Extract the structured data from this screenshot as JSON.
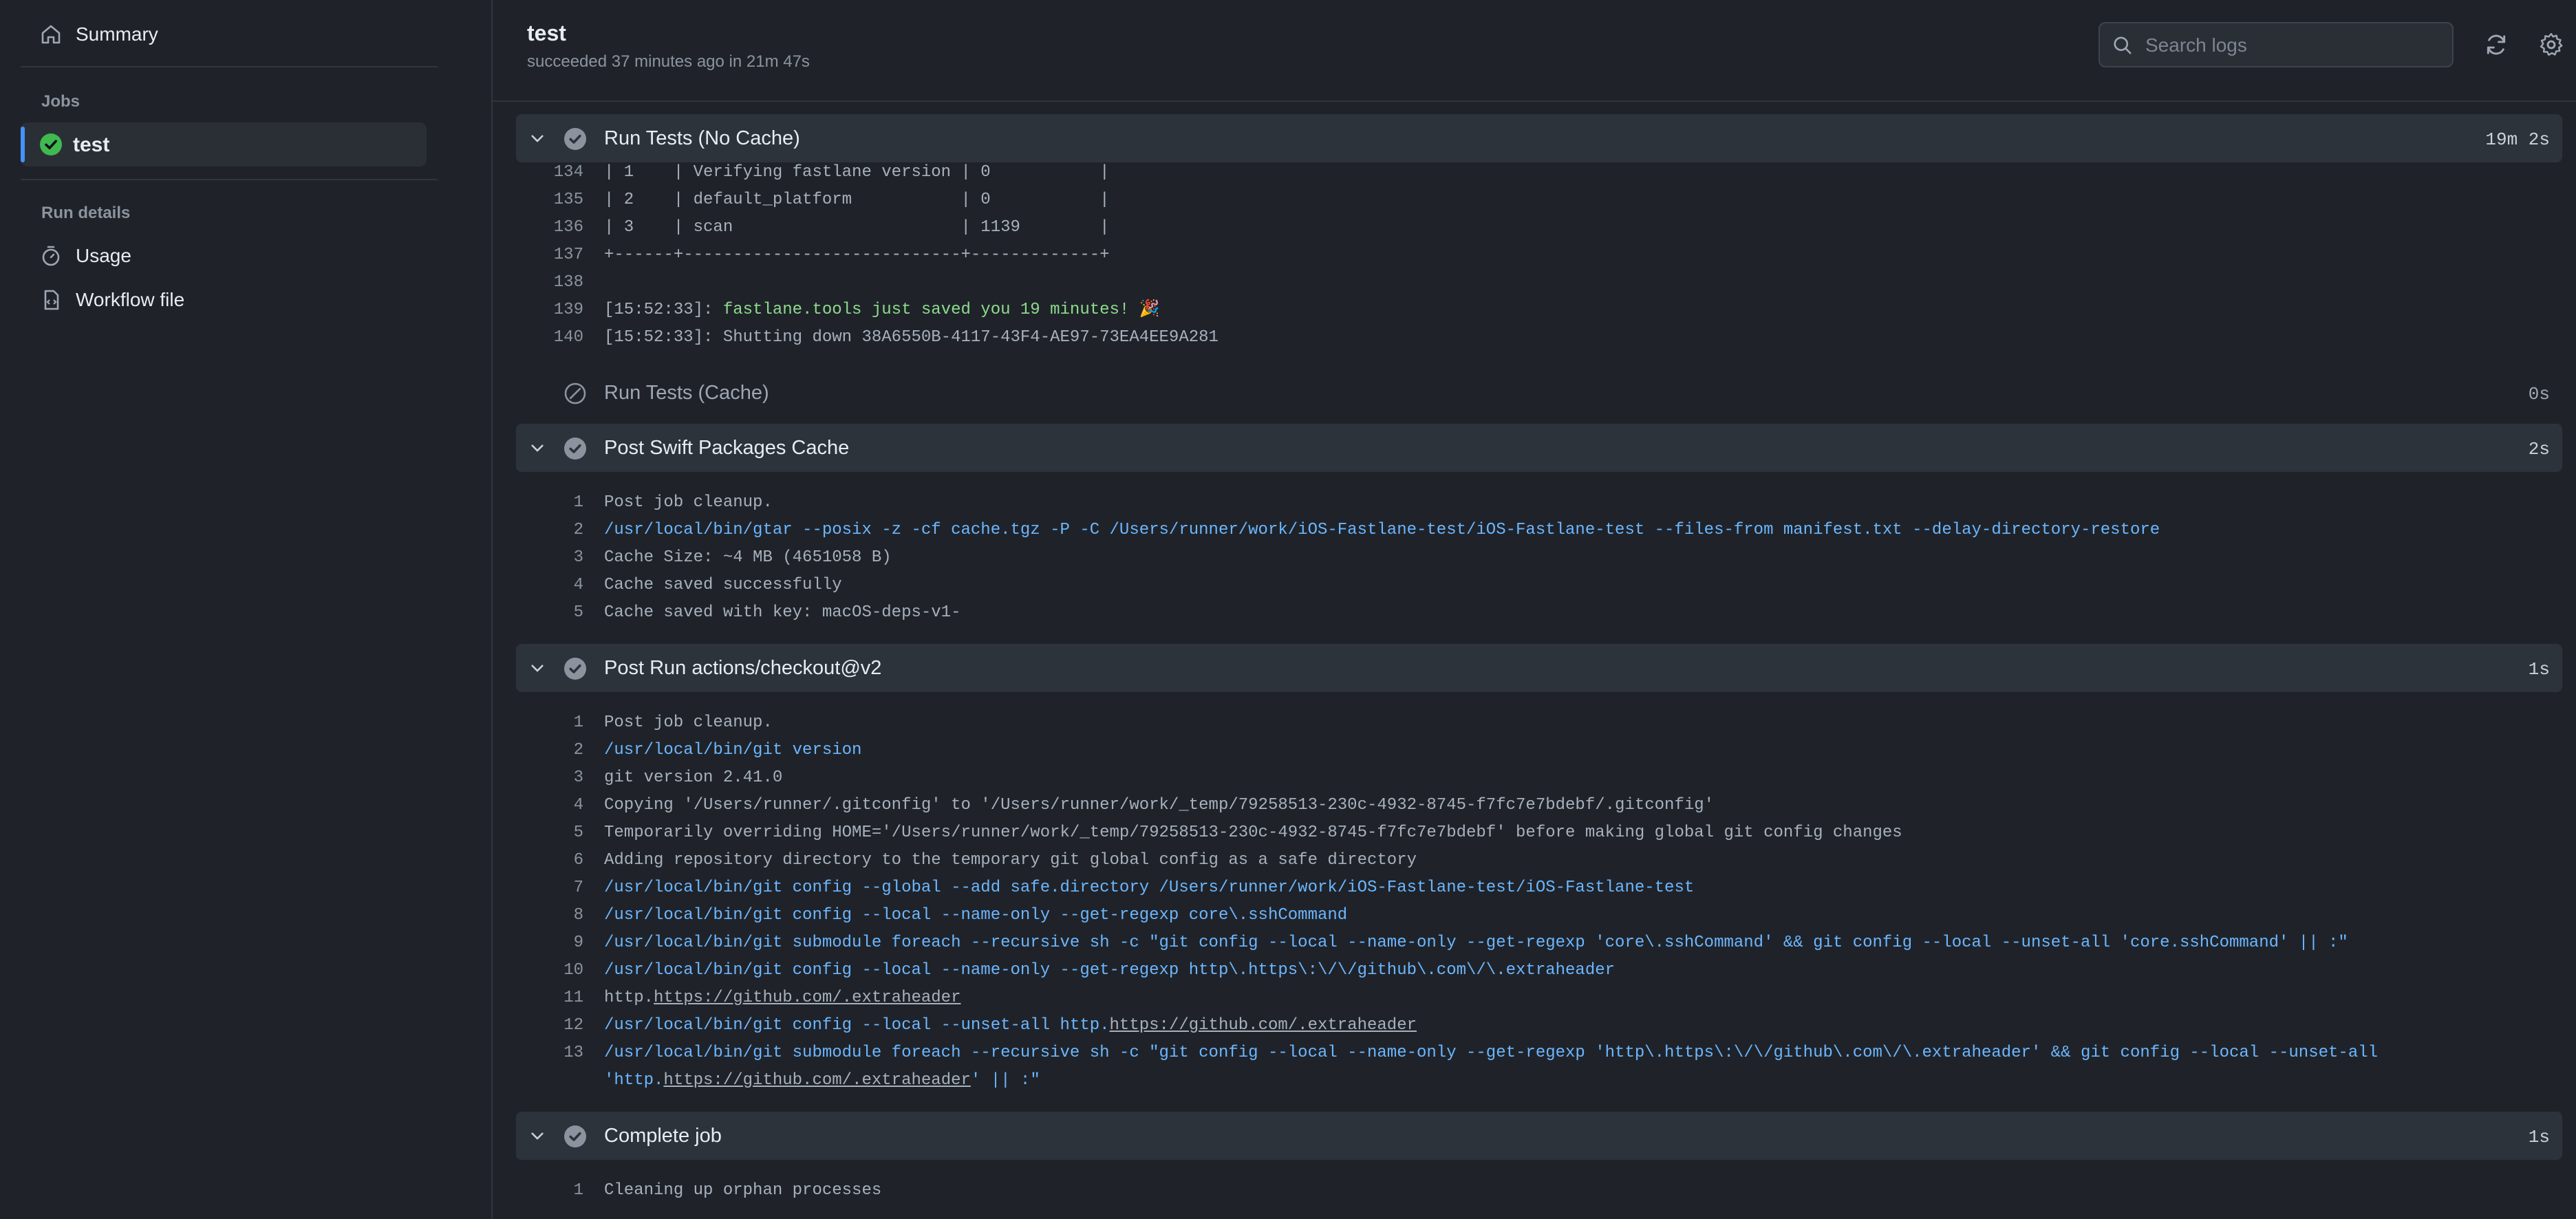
{
  "sidebar": {
    "summary_label": "Summary",
    "jobs_heading": "Jobs",
    "job_label": "test",
    "run_details_heading": "Run details",
    "usage_label": "Usage",
    "workflow_label": "Workflow file"
  },
  "header": {
    "title": "test",
    "subtitle": "succeeded 37 minutes ago in 21m 47s",
    "search_placeholder": "Search logs"
  },
  "steps": [
    {
      "name": "Run Tests (No Cache)",
      "duration": "19m 2s"
    },
    {
      "name": "Run Tests (Cache)",
      "duration": "0s"
    },
    {
      "name": "Post Swift Packages Cache",
      "duration": "2s"
    },
    {
      "name": "Post Run actions/checkout@v2",
      "duration": "1s"
    },
    {
      "name": "Complete job",
      "duration": "1s"
    }
  ],
  "logs": {
    "tests_no_cache": [
      {
        "n": "134",
        "t": "| 1    | Verifying fastlane version | 0           |"
      },
      {
        "n": "135",
        "t": "| 2    | default_platform           | 0           |"
      },
      {
        "n": "136",
        "t": "| 3    | scan                       | 1139        |"
      },
      {
        "n": "137",
        "t": "+------+----------------------------+-------------+"
      },
      {
        "n": "138",
        "t": ""
      },
      {
        "n": "139",
        "pre": "[15:52:33]: ",
        "t": "fastlane.tools just saved you 19 minutes! 🎉"
      },
      {
        "n": "140",
        "t": "[15:52:33]: Shutting down 38A6550B-4117-43F4-AE97-73EA4EE9A281"
      }
    ],
    "swift_cache": [
      {
        "n": "1",
        "t": "Post job cleanup."
      },
      {
        "n": "2",
        "t": "/usr/local/bin/gtar --posix -z -cf cache.tgz -P -C /Users/runner/work/iOS-Fastlane-test/iOS-Fastlane-test --files-from manifest.txt --delay-directory-restore"
      },
      {
        "n": "3",
        "t": "Cache Size: ~4 MB (4651058 B)"
      },
      {
        "n": "4",
        "t": "Cache saved successfully"
      },
      {
        "n": "5",
        "t": "Cache saved with key: macOS-deps-v1-"
      }
    ],
    "checkout": [
      {
        "n": "1",
        "t": "Post job cleanup."
      },
      {
        "n": "2",
        "t": "/usr/local/bin/git version"
      },
      {
        "n": "3",
        "t": "git version 2.41.0"
      },
      {
        "n": "4",
        "t": "Copying '/Users/runner/.gitconfig' to '/Users/runner/work/_temp/79258513-230c-4932-8745-f7fc7e7bdebf/.gitconfig'"
      },
      {
        "n": "5",
        "t": "Temporarily overriding HOME='/Users/runner/work/_temp/79258513-230c-4932-8745-f7fc7e7bdebf' before making global git config changes"
      },
      {
        "n": "6",
        "t": "Adding repository directory to the temporary git global config as a safe directory"
      },
      {
        "n": "7",
        "t": "/usr/local/bin/git config --global --add safe.directory /Users/runner/work/iOS-Fastlane-test/iOS-Fastlane-test"
      },
      {
        "n": "8",
        "t": "/usr/local/bin/git config --local --name-only --get-regexp core\\.sshCommand"
      },
      {
        "n": "9",
        "t": "/usr/local/bin/git submodule foreach --recursive sh -c \"git config --local --name-only --get-regexp 'core\\.sshCommand' && git config --local --unset-all 'core.sshCommand' || :\""
      },
      {
        "n": "10",
        "t": "/usr/local/bin/git config --local --name-only --get-regexp http\\.https\\:\\/\\/github\\.com\\/\\.extraheader"
      },
      {
        "n": "11",
        "pre": "http.",
        "link": "https://github.com/.extraheader"
      },
      {
        "n": "12",
        "pre": "/usr/local/bin/git config --local --unset-all http.",
        "link": "https://github.com/.extraheader"
      },
      {
        "n": "13",
        "t": "/usr/local/bin/git submodule foreach --recursive sh -c \"git config --local --name-only --get-regexp 'http\\.https\\:\\/\\/github\\.com\\/\\.extraheader' && git config --local --unset-all",
        "pre2": "'http.",
        "link2": "https://github.com/.extraheader",
        "post2": "' || :\""
      }
    ],
    "complete": [
      {
        "n": "1",
        "t": "Cleaning up orphan processes"
      }
    ]
  },
  "colors": {
    "accent": "#4493f8",
    "success": "#3fb950",
    "command": "#6cb6ff"
  }
}
